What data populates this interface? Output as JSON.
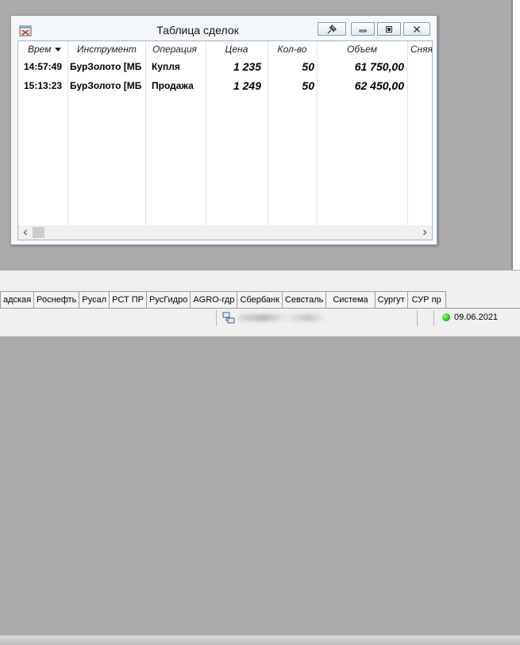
{
  "window": {
    "title": "Таблица сделок"
  },
  "table": {
    "columns": [
      "Врем",
      "Инструмент",
      "Операция",
      "Цена",
      "Кол-во",
      "Объем",
      "Сняя"
    ],
    "rows": [
      {
        "time": "14:57:49",
        "instrument": "БурЗолото [МБ",
        "operation": "Купля",
        "price": "1 235",
        "qty": "50",
        "volume": "61 750,00"
      },
      {
        "time": "15:13:23",
        "instrument": "БурЗолото [МБ",
        "operation": "Продажа",
        "price": "1 249",
        "qty": "50",
        "volume": "62 450,00"
      }
    ]
  },
  "tabs": [
    "адская",
    "Роснефть",
    "Русал",
    "РСТ ПР",
    "РусГидро",
    "AGRO-гдр",
    "Сбербанк",
    "Севсталь",
    "Система",
    "Сургут",
    "СУР пр"
  ],
  "status": {
    "date": "09.06.2021",
    "connection_color": "#1ec21e"
  },
  "icons": {
    "app": "table-window-icon",
    "extra": "pin-icon",
    "minimize": "minimize-icon",
    "maximize": "maximize-icon",
    "close": "close-icon",
    "network": "network-icon"
  }
}
